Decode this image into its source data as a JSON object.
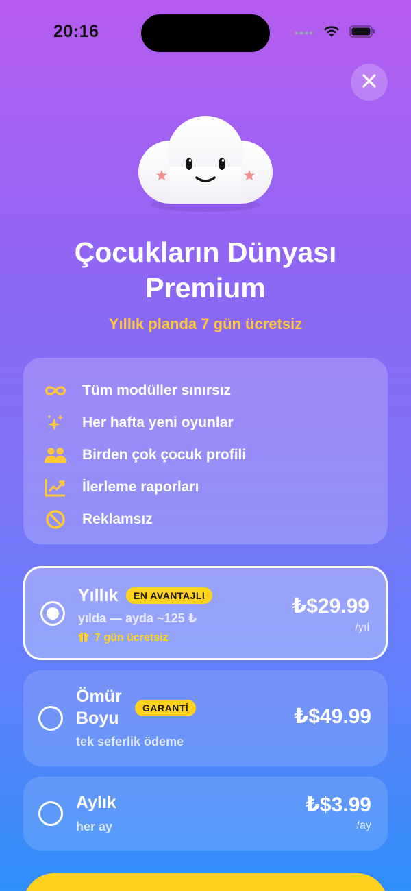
{
  "status_bar": {
    "time": "20:16"
  },
  "close": {
    "icon": "close-icon"
  },
  "header": {
    "title_line1": "Çocukların Dünyası",
    "title_line2": "Premium",
    "subtitle": "Yıllık planda 7 gün ücretsiz"
  },
  "features": [
    {
      "icon": "infinity-icon",
      "label": "Tüm modüller sınırsız"
    },
    {
      "icon": "sparkles-icon",
      "label": "Her hafta yeni oyunlar"
    },
    {
      "icon": "users-icon",
      "label": "Birden çok çocuk profili"
    },
    {
      "icon": "chart-up-icon",
      "label": "İlerleme raporları"
    },
    {
      "icon": "no-ads-icon",
      "label": "Reklamsız"
    }
  ],
  "plans": [
    {
      "name": "Yıllık",
      "badge": "EN AVANTAJLI",
      "description": "yılda — ayda ~125 ₺",
      "trial": "7 gün ücretsiz",
      "price": "₺$29.99",
      "period": "/yıl",
      "selected": true
    },
    {
      "name_line1": "Ömür",
      "name_line2": "Boyu",
      "badge": "GARANTİ",
      "description": "tek seferlik ödeme",
      "price": "₺$49.99",
      "selected": false
    },
    {
      "name": "Aylık",
      "description": "her ay",
      "price": "₺$3.99",
      "period": "/ay",
      "selected": false
    }
  ],
  "colors": {
    "accent_yellow": "#ffd21f",
    "subtitle_yellow": "#ffc83a",
    "gradient_top": "#b65cf0",
    "gradient_bottom": "#2f8ffb"
  }
}
